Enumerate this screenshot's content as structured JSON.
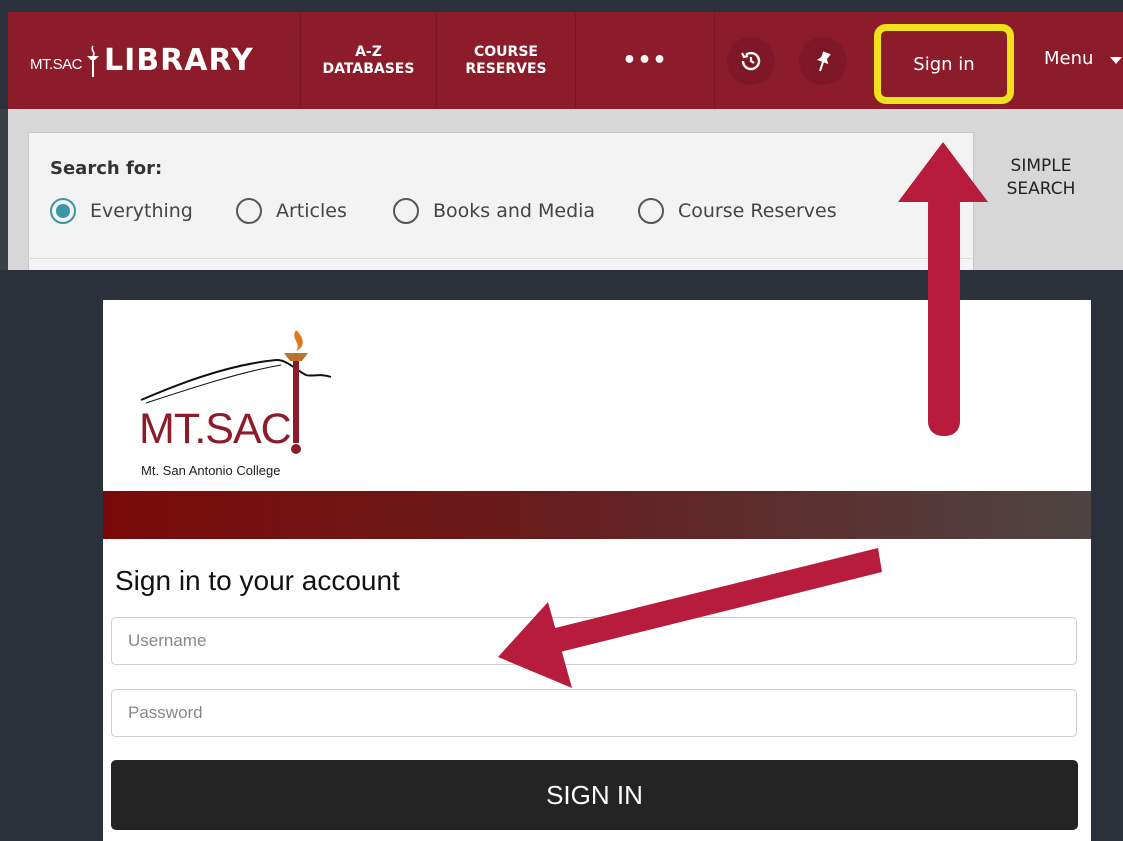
{
  "library": {
    "logo_small": "MT.SAC",
    "logo_big": "LIBRARY",
    "nav": [
      {
        "line1": "A-Z",
        "line2": "DATABASES"
      },
      {
        "line1": "COURSE",
        "line2": "RESERVES"
      }
    ],
    "more_label": "•••",
    "history_icon": "history-icon",
    "pin_icon": "pin-icon",
    "signin_label": "Sign in",
    "menu_label": "Menu",
    "search_for_label": "Search for:",
    "search_options": [
      "Everything",
      "Articles",
      "Books and Media",
      "Course Reserves"
    ],
    "selected_option": "Everything",
    "simple_search_label": "SIMPLE SEARCH",
    "colors": {
      "brand": "#8d1c2a",
      "highlight": "#f0e21a",
      "radio_accent": "#3a97a8"
    }
  },
  "login": {
    "logo_text": "MT.SAC",
    "logo_subtitle": "Mt. San Antonio College",
    "title": "Sign in to your account",
    "username_placeholder": "Username",
    "password_placeholder": "Password",
    "signin_button": "SIGN IN"
  },
  "annotations": {
    "arrow_color": "#b71c3c"
  }
}
